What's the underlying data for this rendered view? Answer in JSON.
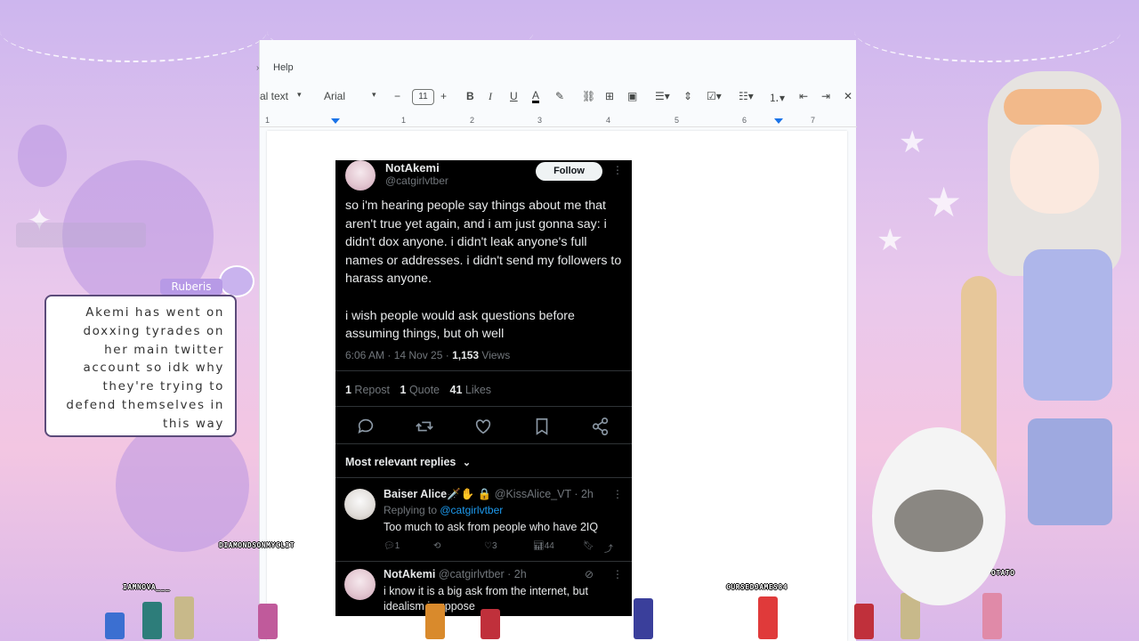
{
  "docs": {
    "menu_help": "Help",
    "style_label": "al text",
    "font_name": "Arial",
    "font_size": "11",
    "ruler_ticks": [
      "1",
      "1",
      "2",
      "3",
      "4",
      "5",
      "6",
      "7"
    ]
  },
  "tweet": {
    "name": "NotAkemi",
    "handle": "@catgirlvtber",
    "follow_label": "Follow",
    "body_p1": "so i'm hearing people say things about me that aren't true yet again, and i am just gonna say: i didn't dox anyone. i didn't leak anyone's full names or addresses. i didn't send my followers to harass anyone.",
    "body_p2": "i wish people would ask questions before assuming things, but oh well",
    "time": "6:06 AM · 14 Nov 25 · ",
    "views_count": "1,153",
    "views_label": " Views",
    "reposts_count": "1",
    "reposts_label": " Repost",
    "quotes_count": "1",
    "quotes_label": " Quote",
    "likes_count": "41",
    "likes_label": " Likes",
    "relevant_label": "Most relevant replies"
  },
  "replies": [
    {
      "name": "Baiser Alice🗡️✋ 🔒",
      "handle": "@KissAlice_VT · 2h",
      "replying_prefix": "Replying to ",
      "replying_to": "@catgirlvtber",
      "text": "Too much to ask from people who have 2IQ",
      "reply_count": "1",
      "like_count": "3",
      "view_count": "44"
    },
    {
      "name": "NotAkemi",
      "handle": "@catgirlvtber · 2h",
      "text": "i know it is a big ask from the internet, but idealism i suppose"
    }
  ],
  "chat": {
    "username": "Ruberis",
    "message": "Akemi has went on doxxing tyrades on her main twitter account so idk why they're trying to defend themselves in this way"
  },
  "overlay_names": {
    "diamond": "DIAMONDSONMYCLIT",
    "iamnova": "IAMNOVA___",
    "cursed": "CURSEDJAMES84",
    "ferro": "FERROPOTATO"
  },
  "colors": {
    "accent_blue": "#1d9bf0",
    "tweet_bg": "#000000",
    "chat_name_bg": "#b79ae6"
  }
}
